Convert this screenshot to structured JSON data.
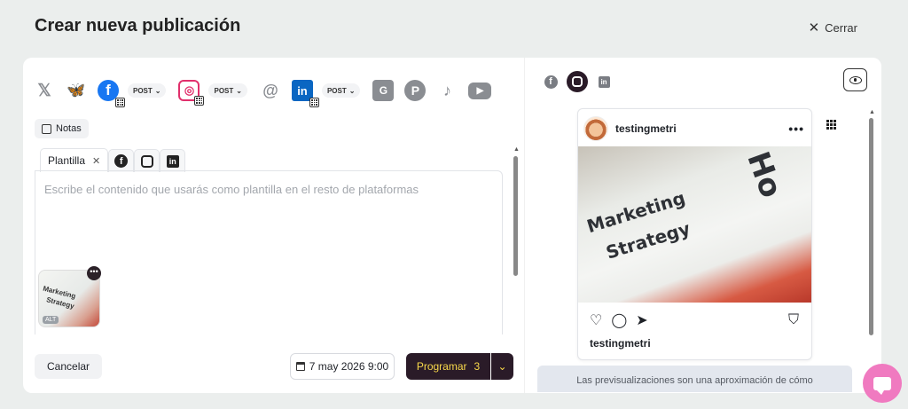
{
  "modal": {
    "title": "Crear nueva publicación",
    "close_label": "Cerrar"
  },
  "platforms": {
    "x": "𝕏",
    "bluesky": "🦋",
    "facebook": "f",
    "facebook_post": "POST",
    "instagram": "◎",
    "instagram_post": "POST",
    "threads": "@",
    "linkedin": "in",
    "linkedin_post": "POST",
    "google_business": "G",
    "pinterest": "P",
    "tiktok": "♪",
    "youtube": "▶"
  },
  "notes_label": "Notas",
  "tabs": [
    {
      "label": "Plantilla"
    }
  ],
  "editor": {
    "placeholder": "Escribe el contenido que usarás como plantilla en el resto de plataformas"
  },
  "media": {
    "thumb_line1": "Marketing",
    "thumb_line2": "Strategy",
    "alt_badge": "ALT"
  },
  "footer": {
    "cancel_label": "Cancelar",
    "date_label": "7 may 2026 9:00",
    "schedule_label": "Programar",
    "schedule_count": "3"
  },
  "preview": {
    "username": "testingmetri",
    "caption_user": "testingmetri",
    "image_text_1": "Marketing",
    "image_text_2": "Strategy",
    "image_text_3": "Ho",
    "disclaimer": "Las previsualizaciones son una aproximación de cómo"
  },
  "colors": {
    "brand_dark": "#2a1b28",
    "accent_yellow": "#f8d84a",
    "facebook": "#1877f2",
    "instagram": "#e1306c",
    "linkedin": "#0a66c2",
    "chat": "#f07ac0"
  }
}
